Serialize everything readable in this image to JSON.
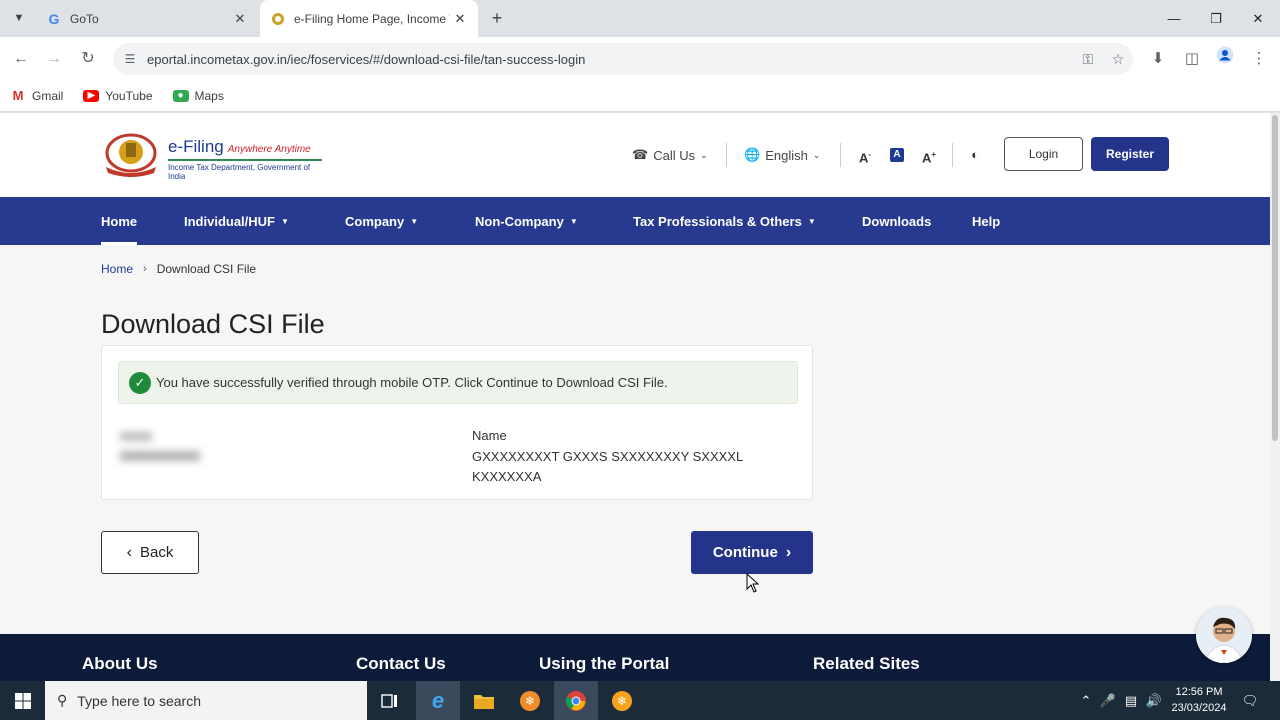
{
  "browser": {
    "tabs": [
      {
        "title": "GoTo",
        "favicon": "G"
      },
      {
        "title": "e-Filing Home Page, Income Ta",
        "favicon": "emblem"
      }
    ],
    "url": "eportal.incometax.gov.in/iec/foservices/#/download-csi-file/tan-success-login",
    "bookmarks": [
      {
        "label": "Gmail",
        "color": "#d93025"
      },
      {
        "label": "YouTube",
        "color": "#ff0000"
      },
      {
        "label": "Maps",
        "color": "#34a853"
      }
    ]
  },
  "header": {
    "logo_main": "e-Filing",
    "logo_tagline": "Anywhere Anytime",
    "logo_sub": "Income Tax Department, Government of India",
    "call_us": "Call Us",
    "language": "English",
    "font_decrease": "A",
    "font_normal": "A",
    "font_increase": "A",
    "login": "Login",
    "register": "Register"
  },
  "nav": {
    "items": [
      {
        "label": "Home",
        "dropdown": false,
        "active": true
      },
      {
        "label": "Individual/HUF",
        "dropdown": true
      },
      {
        "label": "Company",
        "dropdown": true
      },
      {
        "label": "Non-Company",
        "dropdown": true
      },
      {
        "label": "Tax Professionals & Others",
        "dropdown": true
      },
      {
        "label": "Downloads",
        "dropdown": false
      },
      {
        "label": "Help",
        "dropdown": false
      }
    ]
  },
  "breadcrumb": {
    "home": "Home",
    "current": "Download CSI File"
  },
  "main": {
    "title": "Download CSI File",
    "success_message": "You have successfully verified through mobile OTP. Click Continue to Download CSI File.",
    "name_label": "Name",
    "name_value": "GXXXXXXXXT GXXXS SXXXXXXXY SXXXXL KXXXXXXA",
    "back": "Back",
    "continue": "Continue"
  },
  "footer": {
    "headings": [
      "About Us",
      "Contact Us",
      "Using the Portal",
      "Related Sites"
    ]
  },
  "taskbar": {
    "search_placeholder": "Type here to search",
    "time": "12:56 PM",
    "date": "23/03/2024"
  },
  "colors": {
    "primary_blue": "#283a8f",
    "button_blue": "#24348a",
    "success_green": "#1e8a3a",
    "footer_navy": "#0e1a3a"
  }
}
